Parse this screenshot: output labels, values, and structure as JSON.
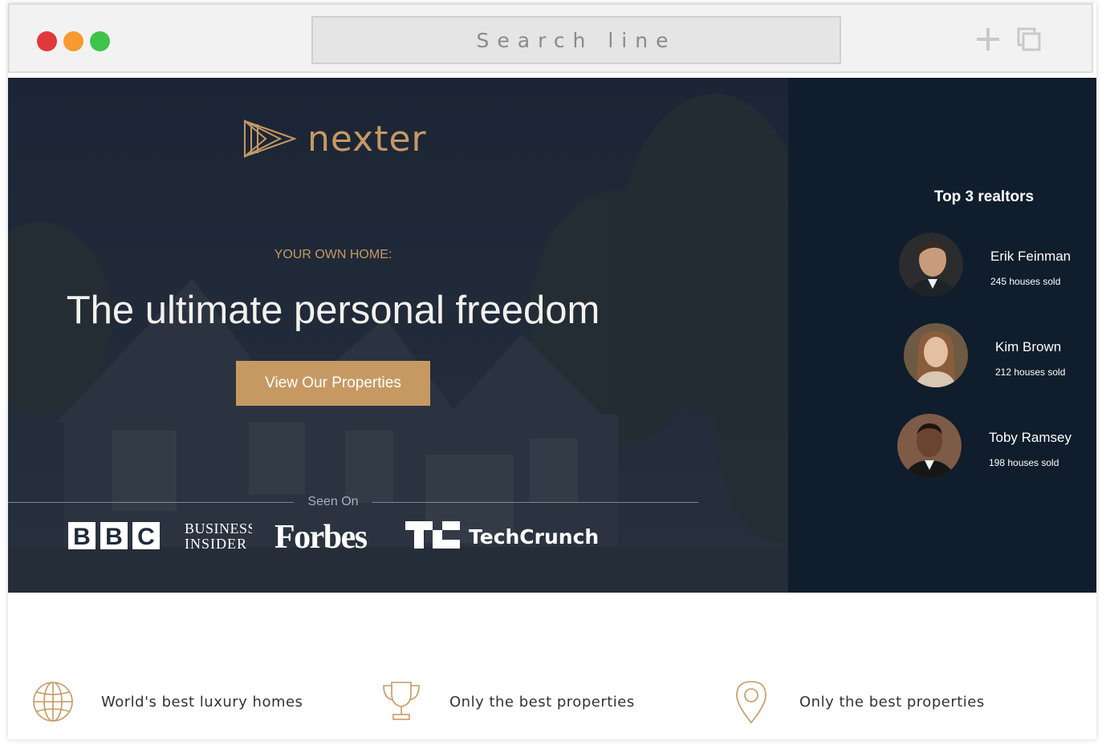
{
  "browser": {
    "search_placeholder": "Search line",
    "traffic_lights": {
      "close": "#e0393b",
      "minimize": "#f79a32",
      "maximize": "#3ec449"
    },
    "icons": {
      "new_tab": "plus-icon",
      "duplicate": "copy-icon"
    }
  },
  "colors": {
    "accent": "#c69963",
    "hero_bg": "#202a3a",
    "sidebar_bg": "#101d2c"
  },
  "hero": {
    "logo_text": "nexter",
    "subtitle": "YOUR OWN HOME:",
    "headline": "The ultimate personal freedom",
    "cta_label": "View Our Properties",
    "seen_on": "Seen On",
    "brands": [
      "BBC",
      "Business Insider",
      "Forbes",
      "TechCrunch"
    ]
  },
  "realtors": {
    "title": "Top 3 realtors",
    "items": [
      {
        "name": "Erik Feinman",
        "sold": "245 houses sold"
      },
      {
        "name": "Kim Brown",
        "sold": "212 houses sold"
      },
      {
        "name": "Toby Ramsey",
        "sold": "198 houses sold"
      }
    ]
  },
  "features": [
    {
      "icon": "globe-icon",
      "text": "World's best luxury homes"
    },
    {
      "icon": "trophy-icon",
      "text": "Only the best properties"
    },
    {
      "icon": "map-pin-icon",
      "text": "Only the best properties"
    }
  ]
}
